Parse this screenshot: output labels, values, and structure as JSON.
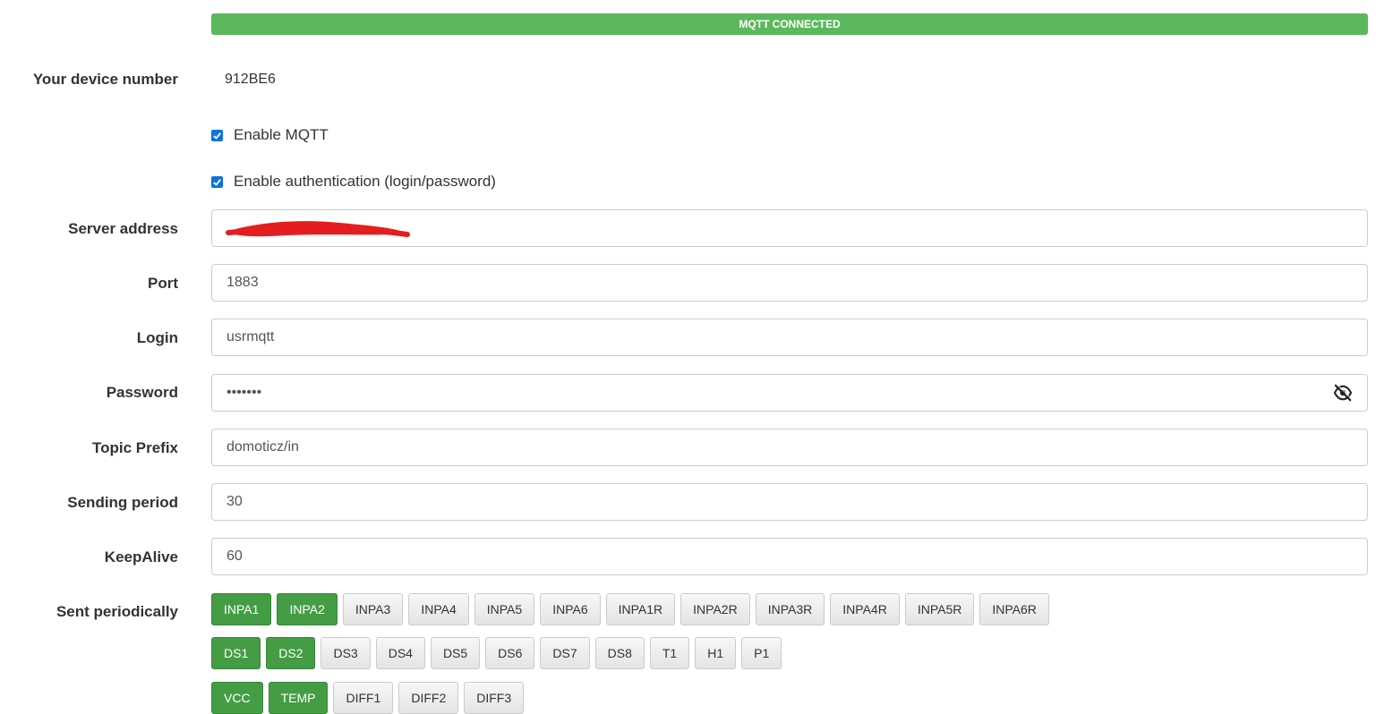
{
  "status": {
    "text": "MQTT CONNECTED",
    "color": "#5cb85c"
  },
  "device": {
    "label": "Your device number",
    "value": "912BE6"
  },
  "checkboxes": [
    {
      "label": "Enable MQTT",
      "checked": true
    },
    {
      "label": "Enable authentication (login/password)",
      "checked": true
    }
  ],
  "fields": {
    "server": {
      "label": "Server address",
      "value": ""
    },
    "port": {
      "label": "Port",
      "value": "1883"
    },
    "login": {
      "label": "Login",
      "value": "usrmqtt"
    },
    "password": {
      "label": "Password",
      "value": "•••••••",
      "toggle_icon": "eye-slash-icon"
    },
    "topic": {
      "label": "Topic Prefix",
      "value": "domoticz/in"
    },
    "period": {
      "label": "Sending period",
      "value": "30"
    },
    "keepalive": {
      "label": "KeepAlive",
      "value": "60"
    }
  },
  "sent_periodically": {
    "label": "Sent periodically",
    "rows": [
      [
        {
          "label": "INPA1",
          "active": true
        },
        {
          "label": "INPA2",
          "active": true
        },
        {
          "label": "INPA3",
          "active": false
        },
        {
          "label": "INPA4",
          "active": false
        },
        {
          "label": "INPA5",
          "active": false
        },
        {
          "label": "INPA6",
          "active": false
        },
        {
          "label": "INPA1R",
          "active": false
        },
        {
          "label": "INPA2R",
          "active": false
        },
        {
          "label": "INPA3R",
          "active": false
        },
        {
          "label": "INPA4R",
          "active": false
        },
        {
          "label": "INPA5R",
          "active": false
        },
        {
          "label": "INPA6R",
          "active": false
        }
      ],
      [
        {
          "label": "DS1",
          "active": true
        },
        {
          "label": "DS2",
          "active": true
        },
        {
          "label": "DS3",
          "active": false
        },
        {
          "label": "DS4",
          "active": false
        },
        {
          "label": "DS5",
          "active": false
        },
        {
          "label": "DS6",
          "active": false
        },
        {
          "label": "DS7",
          "active": false
        },
        {
          "label": "DS8",
          "active": false
        },
        {
          "label": "T1",
          "active": false
        },
        {
          "label": "H1",
          "active": false
        },
        {
          "label": "P1",
          "active": false
        }
      ],
      [
        {
          "label": "VCC",
          "active": true
        },
        {
          "label": "TEMP",
          "active": true
        },
        {
          "label": "DIFF1",
          "active": false
        },
        {
          "label": "DIFF2",
          "active": false
        },
        {
          "label": "DIFF3",
          "active": false
        }
      ]
    ]
  },
  "colors": {
    "active_button": "#449d44",
    "checkbox": "#0b74de",
    "redaction": "#e41e1e"
  }
}
